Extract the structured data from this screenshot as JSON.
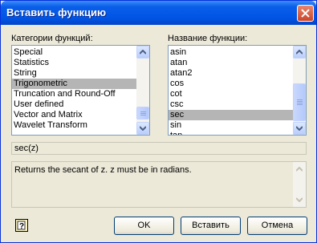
{
  "window": {
    "title": "Вставить функцию"
  },
  "categories": {
    "label": "Категории функций:",
    "items": [
      "Special",
      "Statistics",
      "String",
      "Trigonometric",
      "Truncation and Round-Off",
      "User defined",
      "Vector and Matrix",
      "Wavelet Transform"
    ],
    "selected_index": 3
  },
  "functions": {
    "label": "Название функции:",
    "items": [
      "asin",
      "atan",
      "atan2",
      "cos",
      "cot",
      "csc",
      "sec",
      "sin",
      "tan"
    ],
    "selected_index": 6
  },
  "signature": "sec(z)",
  "description": "Returns the secant of z. z must be in radians.",
  "buttons": {
    "ok": "OK",
    "insert": "Вставить",
    "cancel": "Отмена",
    "help": "?"
  },
  "icons": {
    "close": "close-icon",
    "help": "help-icon",
    "up": "scroll-up-arrow-icon",
    "down": "scroll-down-arrow-icon"
  },
  "colors": {
    "title_bar": "#0055e5",
    "selection": "#b5b5b5",
    "close_button": "#c9452a"
  }
}
